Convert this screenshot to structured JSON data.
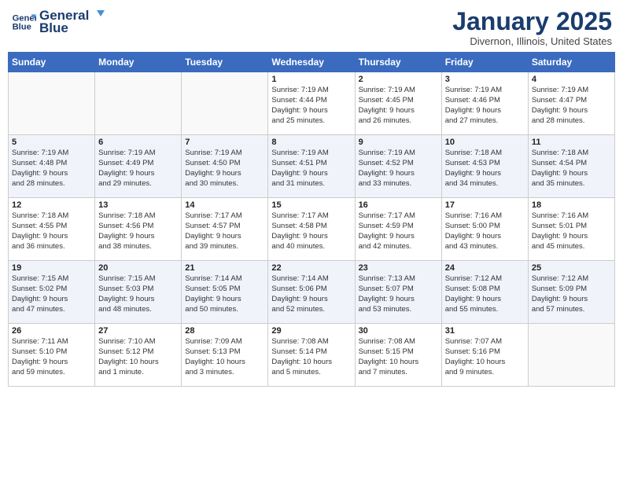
{
  "header": {
    "logo_line1": "General",
    "logo_line2": "Blue",
    "month": "January 2025",
    "location": "Divernon, Illinois, United States"
  },
  "weekdays": [
    "Sunday",
    "Monday",
    "Tuesday",
    "Wednesday",
    "Thursday",
    "Friday",
    "Saturday"
  ],
  "weeks": [
    [
      {
        "day": "",
        "info": ""
      },
      {
        "day": "",
        "info": ""
      },
      {
        "day": "",
        "info": ""
      },
      {
        "day": "1",
        "info": "Sunrise: 7:19 AM\nSunset: 4:44 PM\nDaylight: 9 hours\nand 25 minutes."
      },
      {
        "day": "2",
        "info": "Sunrise: 7:19 AM\nSunset: 4:45 PM\nDaylight: 9 hours\nand 26 minutes."
      },
      {
        "day": "3",
        "info": "Sunrise: 7:19 AM\nSunset: 4:46 PM\nDaylight: 9 hours\nand 27 minutes."
      },
      {
        "day": "4",
        "info": "Sunrise: 7:19 AM\nSunset: 4:47 PM\nDaylight: 9 hours\nand 28 minutes."
      }
    ],
    [
      {
        "day": "5",
        "info": "Sunrise: 7:19 AM\nSunset: 4:48 PM\nDaylight: 9 hours\nand 28 minutes."
      },
      {
        "day": "6",
        "info": "Sunrise: 7:19 AM\nSunset: 4:49 PM\nDaylight: 9 hours\nand 29 minutes."
      },
      {
        "day": "7",
        "info": "Sunrise: 7:19 AM\nSunset: 4:50 PM\nDaylight: 9 hours\nand 30 minutes."
      },
      {
        "day": "8",
        "info": "Sunrise: 7:19 AM\nSunset: 4:51 PM\nDaylight: 9 hours\nand 31 minutes."
      },
      {
        "day": "9",
        "info": "Sunrise: 7:19 AM\nSunset: 4:52 PM\nDaylight: 9 hours\nand 33 minutes."
      },
      {
        "day": "10",
        "info": "Sunrise: 7:18 AM\nSunset: 4:53 PM\nDaylight: 9 hours\nand 34 minutes."
      },
      {
        "day": "11",
        "info": "Sunrise: 7:18 AM\nSunset: 4:54 PM\nDaylight: 9 hours\nand 35 minutes."
      }
    ],
    [
      {
        "day": "12",
        "info": "Sunrise: 7:18 AM\nSunset: 4:55 PM\nDaylight: 9 hours\nand 36 minutes."
      },
      {
        "day": "13",
        "info": "Sunrise: 7:18 AM\nSunset: 4:56 PM\nDaylight: 9 hours\nand 38 minutes."
      },
      {
        "day": "14",
        "info": "Sunrise: 7:17 AM\nSunset: 4:57 PM\nDaylight: 9 hours\nand 39 minutes."
      },
      {
        "day": "15",
        "info": "Sunrise: 7:17 AM\nSunset: 4:58 PM\nDaylight: 9 hours\nand 40 minutes."
      },
      {
        "day": "16",
        "info": "Sunrise: 7:17 AM\nSunset: 4:59 PM\nDaylight: 9 hours\nand 42 minutes."
      },
      {
        "day": "17",
        "info": "Sunrise: 7:16 AM\nSunset: 5:00 PM\nDaylight: 9 hours\nand 43 minutes."
      },
      {
        "day": "18",
        "info": "Sunrise: 7:16 AM\nSunset: 5:01 PM\nDaylight: 9 hours\nand 45 minutes."
      }
    ],
    [
      {
        "day": "19",
        "info": "Sunrise: 7:15 AM\nSunset: 5:02 PM\nDaylight: 9 hours\nand 47 minutes."
      },
      {
        "day": "20",
        "info": "Sunrise: 7:15 AM\nSunset: 5:03 PM\nDaylight: 9 hours\nand 48 minutes."
      },
      {
        "day": "21",
        "info": "Sunrise: 7:14 AM\nSunset: 5:05 PM\nDaylight: 9 hours\nand 50 minutes."
      },
      {
        "day": "22",
        "info": "Sunrise: 7:14 AM\nSunset: 5:06 PM\nDaylight: 9 hours\nand 52 minutes."
      },
      {
        "day": "23",
        "info": "Sunrise: 7:13 AM\nSunset: 5:07 PM\nDaylight: 9 hours\nand 53 minutes."
      },
      {
        "day": "24",
        "info": "Sunrise: 7:12 AM\nSunset: 5:08 PM\nDaylight: 9 hours\nand 55 minutes."
      },
      {
        "day": "25",
        "info": "Sunrise: 7:12 AM\nSunset: 5:09 PM\nDaylight: 9 hours\nand 57 minutes."
      }
    ],
    [
      {
        "day": "26",
        "info": "Sunrise: 7:11 AM\nSunset: 5:10 PM\nDaylight: 9 hours\nand 59 minutes."
      },
      {
        "day": "27",
        "info": "Sunrise: 7:10 AM\nSunset: 5:12 PM\nDaylight: 10 hours\nand 1 minute."
      },
      {
        "day": "28",
        "info": "Sunrise: 7:09 AM\nSunset: 5:13 PM\nDaylight: 10 hours\nand 3 minutes."
      },
      {
        "day": "29",
        "info": "Sunrise: 7:08 AM\nSunset: 5:14 PM\nDaylight: 10 hours\nand 5 minutes."
      },
      {
        "day": "30",
        "info": "Sunrise: 7:08 AM\nSunset: 5:15 PM\nDaylight: 10 hours\nand 7 minutes."
      },
      {
        "day": "31",
        "info": "Sunrise: 7:07 AM\nSunset: 5:16 PM\nDaylight: 10 hours\nand 9 minutes."
      },
      {
        "day": "",
        "info": ""
      }
    ]
  ]
}
